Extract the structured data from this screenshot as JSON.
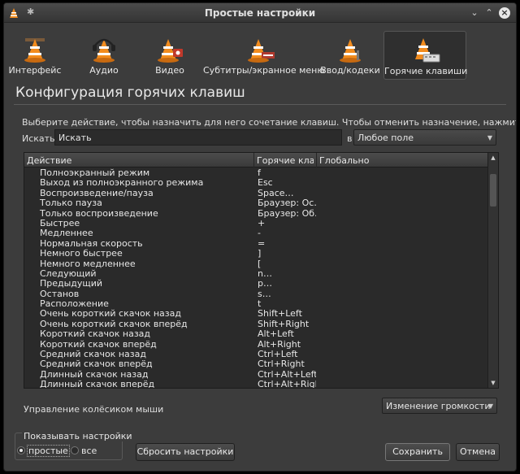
{
  "window": {
    "title": "Простые настройки"
  },
  "categories": [
    {
      "label": "Интерфейс",
      "icon": "interface-cone-icon"
    },
    {
      "label": "Аудио",
      "icon": "audio-cone-icon"
    },
    {
      "label": "Видео",
      "icon": "video-cone-icon"
    },
    {
      "label": "Субтитры/экранное меню",
      "icon": "subtitles-cone-icon"
    },
    {
      "label": "Ввод/кодеки",
      "icon": "input-codecs-cone-icon"
    },
    {
      "label": "Горячие клавиши",
      "icon": "hotkeys-cone-icon"
    }
  ],
  "active_category": "Горячие клавиши",
  "section_title": "Конфигурация горячих клавиш",
  "hint": "Выберите действие, чтобы назначить для него сочетание клавиш. Чтобы отменить назначение, нажмите Delete.",
  "search": {
    "label": "Искать",
    "value": "Искать",
    "in_label": "в",
    "field_select": "Любое поле"
  },
  "table": {
    "headers": [
      "Действие",
      "Горячие клавиши",
      "Глобально"
    ],
    "rows": [
      [
        "Полноэкранный режим",
        "f"
      ],
      [
        "Выход из полноэкранного режима",
        "Esc"
      ],
      [
        "Воспроизведение/пауза",
        "Space…"
      ],
      [
        "Только пауза",
        "Браузер: Ос…"
      ],
      [
        "Только воспроизведение",
        "Браузер: Об…"
      ],
      [
        "Быстрее",
        "+"
      ],
      [
        "Медленнее",
        "-"
      ],
      [
        "Нормальная скорость",
        "="
      ],
      [
        "Немного быстрее",
        "]"
      ],
      [
        "Немного медленнее",
        "["
      ],
      [
        "Следующий",
        "n…"
      ],
      [
        "Предыдущий",
        "p…"
      ],
      [
        "Останов",
        "s…"
      ],
      [
        "Расположение",
        "t"
      ],
      [
        "Очень короткий скачок назад",
        "Shift+Left"
      ],
      [
        "Очень короткий скачок вперёд",
        "Shift+Right"
      ],
      [
        "Короткий скачок назад",
        "Alt+Left"
      ],
      [
        "Короткий скачок вперёд",
        "Alt+Right"
      ],
      [
        "Средний скачок назад",
        "Ctrl+Left"
      ],
      [
        "Средний скачок вперёд",
        "Ctrl+Right"
      ],
      [
        "Длинный скачок назад",
        "Ctrl+Alt+Left"
      ],
      [
        "Длинный скачок вперёд",
        "Ctrl+Alt+Right"
      ]
    ]
  },
  "mouse_wheel": {
    "label": "Управление колёсиком мыши",
    "value": "Изменение громкости"
  },
  "show_settings": {
    "label": "Показывать настройки",
    "simple": "простые",
    "all": "все",
    "selected": "простые"
  },
  "buttons": {
    "reset": "Сбросить настройки",
    "save": "Сохранить",
    "cancel": "Отмена"
  },
  "colors": {
    "window_bg": "#3c3c3c",
    "cone_orange": "#f28c1e",
    "cone_white": "#ffffff"
  }
}
